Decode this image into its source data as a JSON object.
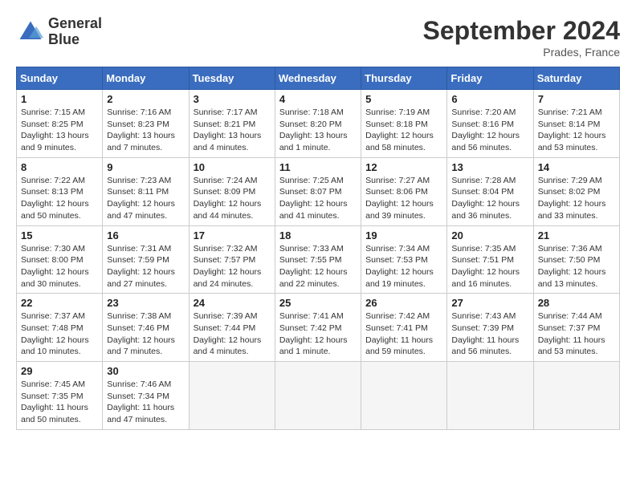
{
  "logo": {
    "line1": "General",
    "line2": "Blue"
  },
  "title": "September 2024",
  "location": "Prades, France",
  "days_header": [
    "Sunday",
    "Monday",
    "Tuesday",
    "Wednesday",
    "Thursday",
    "Friday",
    "Saturday"
  ],
  "weeks": [
    [
      {
        "day": 1,
        "info": "Sunrise: 7:15 AM\nSunset: 8:25 PM\nDaylight: 13 hours\nand 9 minutes."
      },
      {
        "day": 2,
        "info": "Sunrise: 7:16 AM\nSunset: 8:23 PM\nDaylight: 13 hours\nand 7 minutes."
      },
      {
        "day": 3,
        "info": "Sunrise: 7:17 AM\nSunset: 8:21 PM\nDaylight: 13 hours\nand 4 minutes."
      },
      {
        "day": 4,
        "info": "Sunrise: 7:18 AM\nSunset: 8:20 PM\nDaylight: 13 hours\nand 1 minute."
      },
      {
        "day": 5,
        "info": "Sunrise: 7:19 AM\nSunset: 8:18 PM\nDaylight: 12 hours\nand 58 minutes."
      },
      {
        "day": 6,
        "info": "Sunrise: 7:20 AM\nSunset: 8:16 PM\nDaylight: 12 hours\nand 56 minutes."
      },
      {
        "day": 7,
        "info": "Sunrise: 7:21 AM\nSunset: 8:14 PM\nDaylight: 12 hours\nand 53 minutes."
      }
    ],
    [
      {
        "day": 8,
        "info": "Sunrise: 7:22 AM\nSunset: 8:13 PM\nDaylight: 12 hours\nand 50 minutes."
      },
      {
        "day": 9,
        "info": "Sunrise: 7:23 AM\nSunset: 8:11 PM\nDaylight: 12 hours\nand 47 minutes."
      },
      {
        "day": 10,
        "info": "Sunrise: 7:24 AM\nSunset: 8:09 PM\nDaylight: 12 hours\nand 44 minutes."
      },
      {
        "day": 11,
        "info": "Sunrise: 7:25 AM\nSunset: 8:07 PM\nDaylight: 12 hours\nand 41 minutes."
      },
      {
        "day": 12,
        "info": "Sunrise: 7:27 AM\nSunset: 8:06 PM\nDaylight: 12 hours\nand 39 minutes."
      },
      {
        "day": 13,
        "info": "Sunrise: 7:28 AM\nSunset: 8:04 PM\nDaylight: 12 hours\nand 36 minutes."
      },
      {
        "day": 14,
        "info": "Sunrise: 7:29 AM\nSunset: 8:02 PM\nDaylight: 12 hours\nand 33 minutes."
      }
    ],
    [
      {
        "day": 15,
        "info": "Sunrise: 7:30 AM\nSunset: 8:00 PM\nDaylight: 12 hours\nand 30 minutes."
      },
      {
        "day": 16,
        "info": "Sunrise: 7:31 AM\nSunset: 7:59 PM\nDaylight: 12 hours\nand 27 minutes."
      },
      {
        "day": 17,
        "info": "Sunrise: 7:32 AM\nSunset: 7:57 PM\nDaylight: 12 hours\nand 24 minutes."
      },
      {
        "day": 18,
        "info": "Sunrise: 7:33 AM\nSunset: 7:55 PM\nDaylight: 12 hours\nand 22 minutes."
      },
      {
        "day": 19,
        "info": "Sunrise: 7:34 AM\nSunset: 7:53 PM\nDaylight: 12 hours\nand 19 minutes."
      },
      {
        "day": 20,
        "info": "Sunrise: 7:35 AM\nSunset: 7:51 PM\nDaylight: 12 hours\nand 16 minutes."
      },
      {
        "day": 21,
        "info": "Sunrise: 7:36 AM\nSunset: 7:50 PM\nDaylight: 12 hours\nand 13 minutes."
      }
    ],
    [
      {
        "day": 22,
        "info": "Sunrise: 7:37 AM\nSunset: 7:48 PM\nDaylight: 12 hours\nand 10 minutes."
      },
      {
        "day": 23,
        "info": "Sunrise: 7:38 AM\nSunset: 7:46 PM\nDaylight: 12 hours\nand 7 minutes."
      },
      {
        "day": 24,
        "info": "Sunrise: 7:39 AM\nSunset: 7:44 PM\nDaylight: 12 hours\nand 4 minutes."
      },
      {
        "day": 25,
        "info": "Sunrise: 7:41 AM\nSunset: 7:42 PM\nDaylight: 12 hours\nand 1 minute."
      },
      {
        "day": 26,
        "info": "Sunrise: 7:42 AM\nSunset: 7:41 PM\nDaylight: 11 hours\nand 59 minutes."
      },
      {
        "day": 27,
        "info": "Sunrise: 7:43 AM\nSunset: 7:39 PM\nDaylight: 11 hours\nand 56 minutes."
      },
      {
        "day": 28,
        "info": "Sunrise: 7:44 AM\nSunset: 7:37 PM\nDaylight: 11 hours\nand 53 minutes."
      }
    ],
    [
      {
        "day": 29,
        "info": "Sunrise: 7:45 AM\nSunset: 7:35 PM\nDaylight: 11 hours\nand 50 minutes."
      },
      {
        "day": 30,
        "info": "Sunrise: 7:46 AM\nSunset: 7:34 PM\nDaylight: 11 hours\nand 47 minutes."
      },
      null,
      null,
      null,
      null,
      null
    ]
  ]
}
